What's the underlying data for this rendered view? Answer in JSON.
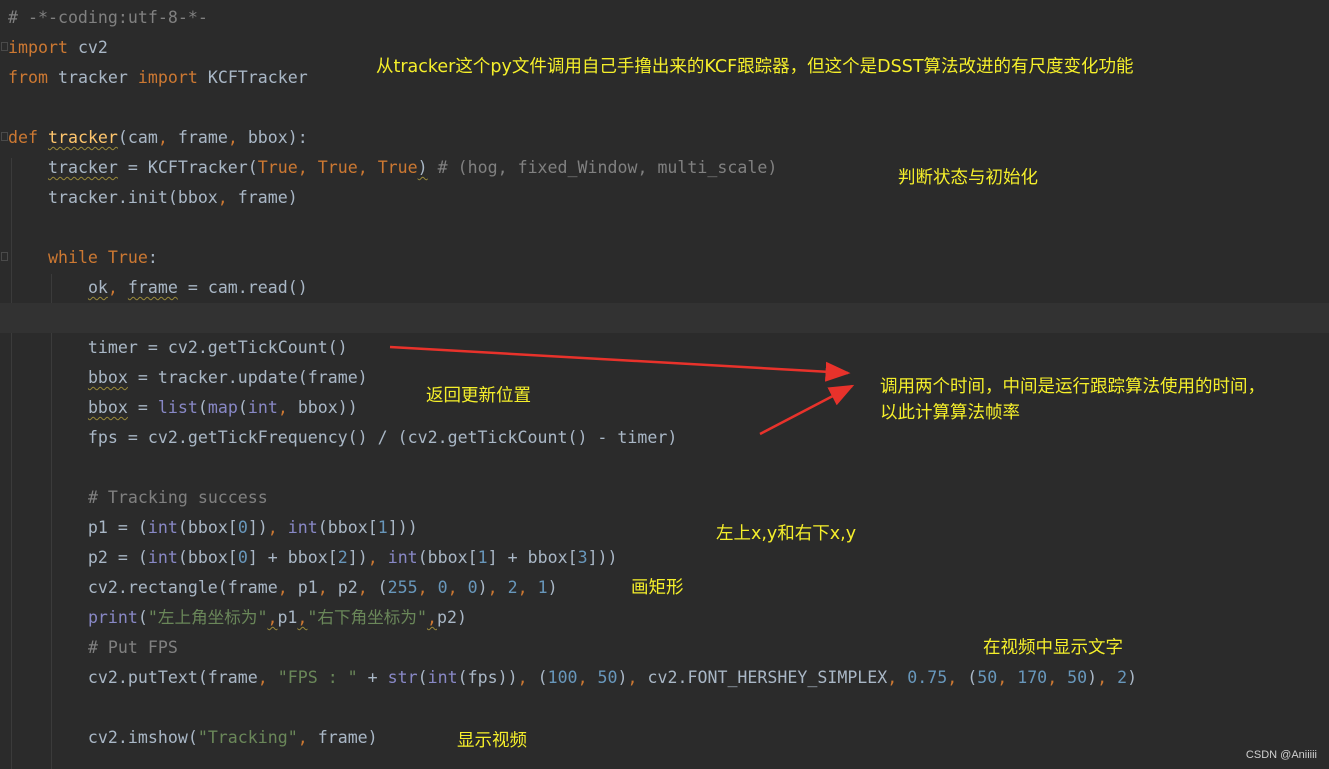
{
  "code_lines": [
    [
      {
        "t": "# -*-coding:utf-8-*-",
        "c": "comment"
      }
    ],
    [
      {
        "t": "import",
        "c": "kw"
      },
      {
        "t": " cv2"
      }
    ],
    [
      {
        "t": "from",
        "c": "kw"
      },
      {
        "t": " tracker "
      },
      {
        "t": "import",
        "c": "kw"
      },
      {
        "t": " KCFTracker"
      }
    ],
    [],
    [
      {
        "t": "def",
        "c": "kw"
      },
      {
        "t": " "
      },
      {
        "t": "tracker",
        "c": "func",
        "s": true
      },
      {
        "t": "(cam"
      },
      {
        "t": ", ",
        "c": "kw"
      },
      {
        "t": "frame"
      },
      {
        "t": ", ",
        "c": "kw"
      },
      {
        "t": "bbox):"
      }
    ],
    [
      {
        "t": "    "
      },
      {
        "t": "tracker",
        "s": true
      },
      {
        "t": " = KCFTracker("
      },
      {
        "t": "True",
        "c": "kw"
      },
      {
        "t": ", ",
        "c": "kw"
      },
      {
        "t": "True",
        "c": "kw"
      },
      {
        "t": ", ",
        "c": "kw"
      },
      {
        "t": "True",
        "c": "kw"
      },
      {
        "t": ")",
        "s": true
      },
      {
        "t": " "
      },
      {
        "t": "# (hog, fixed_Window, multi_scale)",
        "c": "comment"
      }
    ],
    [
      {
        "t": "    tracker.init(bbox"
      },
      {
        "t": ", ",
        "c": "kw"
      },
      {
        "t": "frame)"
      }
    ],
    [],
    [
      {
        "t": "    "
      },
      {
        "t": "while",
        "c": "kw"
      },
      {
        "t": " "
      },
      {
        "t": "True",
        "c": "kw"
      },
      {
        "t": ":"
      }
    ],
    [
      {
        "t": "        "
      },
      {
        "t": "ok",
        "s": true
      },
      {
        "t": ", ",
        "c": "kw"
      },
      {
        "t": "frame",
        "s": true
      },
      {
        "t": " = cam.read()"
      }
    ],
    [],
    [
      {
        "t": "        timer = cv2.getTickCount()"
      }
    ],
    [
      {
        "t": "        "
      },
      {
        "t": "bbox",
        "s": true
      },
      {
        "t": " = tracker.update(frame)"
      }
    ],
    [
      {
        "t": "        "
      },
      {
        "t": "bbox",
        "s": true
      },
      {
        "t": " = "
      },
      {
        "t": "list",
        "c": "builtin"
      },
      {
        "t": "("
      },
      {
        "t": "map",
        "c": "builtin"
      },
      {
        "t": "("
      },
      {
        "t": "int",
        "c": "builtin"
      },
      {
        "t": ", ",
        "c": "kw"
      },
      {
        "t": "bbox))"
      }
    ],
    [
      {
        "t": "        fps = cv2.getTickFrequency() / (cv2.getTickCount() - timer)"
      }
    ],
    [],
    [
      {
        "t": "        "
      },
      {
        "t": "# Tracking success",
        "c": "comment"
      }
    ],
    [
      {
        "t": "        p1 = ("
      },
      {
        "t": "int",
        "c": "builtin"
      },
      {
        "t": "(bbox["
      },
      {
        "t": "0",
        "c": "num"
      },
      {
        "t": "])"
      },
      {
        "t": ", ",
        "c": "kw"
      },
      {
        "t": "int",
        "c": "builtin"
      },
      {
        "t": "(bbox["
      },
      {
        "t": "1",
        "c": "num"
      },
      {
        "t": "]))"
      }
    ],
    [
      {
        "t": "        p2 = ("
      },
      {
        "t": "int",
        "c": "builtin"
      },
      {
        "t": "(bbox["
      },
      {
        "t": "0",
        "c": "num"
      },
      {
        "t": "] + bbox["
      },
      {
        "t": "2",
        "c": "num"
      },
      {
        "t": "])"
      },
      {
        "t": ", ",
        "c": "kw"
      },
      {
        "t": "int",
        "c": "builtin"
      },
      {
        "t": "(bbox["
      },
      {
        "t": "1",
        "c": "num"
      },
      {
        "t": "] + bbox["
      },
      {
        "t": "3",
        "c": "num"
      },
      {
        "t": "]))"
      }
    ],
    [
      {
        "t": "        cv2.rectangle(frame"
      },
      {
        "t": ", ",
        "c": "kw"
      },
      {
        "t": "p1"
      },
      {
        "t": ", ",
        "c": "kw"
      },
      {
        "t": "p2"
      },
      {
        "t": ", ",
        "c": "kw"
      },
      {
        "t": "("
      },
      {
        "t": "255",
        "c": "num"
      },
      {
        "t": ", ",
        "c": "kw"
      },
      {
        "t": "0",
        "c": "num"
      },
      {
        "t": ", ",
        "c": "kw"
      },
      {
        "t": "0",
        "c": "num"
      },
      {
        "t": ")"
      },
      {
        "t": ", ",
        "c": "kw"
      },
      {
        "t": "2",
        "c": "num"
      },
      {
        "t": ", ",
        "c": "kw"
      },
      {
        "t": "1",
        "c": "num"
      },
      {
        "t": ")"
      }
    ],
    [
      {
        "t": "        "
      },
      {
        "t": "print",
        "c": "builtin"
      },
      {
        "t": "("
      },
      {
        "t": "\"左上角坐标为\"",
        "c": "str"
      },
      {
        "t": ",",
        "c": "kw",
        "s": true
      },
      {
        "t": "p1"
      },
      {
        "t": ",",
        "c": "kw",
        "s": true
      },
      {
        "t": "\"右下角坐标为\"",
        "c": "str"
      },
      {
        "t": ",",
        "c": "kw",
        "s": true
      },
      {
        "t": "p2)"
      }
    ],
    [
      {
        "t": "        "
      },
      {
        "t": "# Put FPS",
        "c": "comment"
      }
    ],
    [
      {
        "t": "        cv2.putText(frame"
      },
      {
        "t": ", ",
        "c": "kw"
      },
      {
        "t": "\"FPS : \"",
        "c": "str"
      },
      {
        "t": " + "
      },
      {
        "t": "str",
        "c": "builtin"
      },
      {
        "t": "("
      },
      {
        "t": "int",
        "c": "builtin"
      },
      {
        "t": "(fps))"
      },
      {
        "t": ", ",
        "c": "kw"
      },
      {
        "t": "("
      },
      {
        "t": "100",
        "c": "num"
      },
      {
        "t": ", ",
        "c": "kw"
      },
      {
        "t": "50",
        "c": "num"
      },
      {
        "t": ")"
      },
      {
        "t": ", ",
        "c": "kw"
      },
      {
        "t": "cv2.FONT_HERSHEY_SIMPLEX"
      },
      {
        "t": ", ",
        "c": "kw"
      },
      {
        "t": "0.75",
        "c": "num"
      },
      {
        "t": ", ",
        "c": "kw"
      },
      {
        "t": "("
      },
      {
        "t": "50",
        "c": "num"
      },
      {
        "t": ", ",
        "c": "kw"
      },
      {
        "t": "170",
        "c": "num"
      },
      {
        "t": ", ",
        "c": "kw"
      },
      {
        "t": "50",
        "c": "num"
      },
      {
        "t": ")"
      },
      {
        "t": ", ",
        "c": "kw"
      },
      {
        "t": "2",
        "c": "num"
      },
      {
        "t": ")"
      }
    ],
    [],
    [
      {
        "t": "        cv2.imshow("
      },
      {
        "t": "\"Tracking\"",
        "c": "str"
      },
      {
        "t": ", ",
        "c": "kw"
      },
      {
        "t": "frame)"
      }
    ]
  ],
  "current_line_index": 10,
  "annotations": {
    "import_note": "从tracker这个py文件调用自己手撸出来的KCF跟踪器，但这个是DSST算法改进的有尺度变化功能",
    "init_note": "判断状态与初始化",
    "update_note": "返回更新位置",
    "timing_note_line1": "调用两个时间，中间是运行跟踪算法使用的时间，",
    "timing_note_line2": "以此计算算法帧率",
    "corners_note": "左上x,y和右下x,y",
    "rectangle_note": "画矩形",
    "puttext_note": "在视频中显示文字",
    "imshow_note": "显示视频"
  },
  "colors": {
    "background": "#2b2b2b",
    "keyword": "#cc7832",
    "string": "#6a8759",
    "number": "#6897bb",
    "comment": "#808080",
    "builtin": "#8888c6",
    "function_name": "#ffc66d",
    "annotation_text": "#f5ef2b",
    "arrow": "#e8322b"
  },
  "watermark": "CSDN @Aniiiii"
}
